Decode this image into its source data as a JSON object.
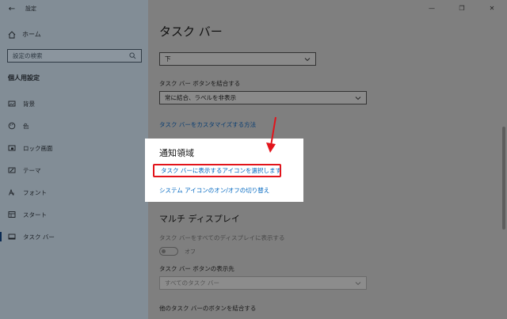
{
  "window": {
    "title": "設定"
  },
  "sidebar": {
    "home": "ホーム",
    "search_placeholder": "設定の検索",
    "section_title": "個人用設定",
    "items": [
      {
        "label": "背景",
        "icon": "image-icon"
      },
      {
        "label": "色",
        "icon": "palette-icon"
      },
      {
        "label": "ロック画面",
        "icon": "lock-screen-icon"
      },
      {
        "label": "テーマ",
        "icon": "theme-icon"
      },
      {
        "label": "フォント",
        "icon": "font-icon"
      },
      {
        "label": "スタート",
        "icon": "start-icon"
      },
      {
        "label": "タスク バー",
        "icon": "taskbar-icon",
        "active": true
      }
    ]
  },
  "main": {
    "title": "タスク バー",
    "position_dropdown": "下",
    "combine_label": "タスク バー ボタンを結合する",
    "combine_dropdown": "常に結合、ラベルを非表示",
    "customize_link": "タスク バーをカスタマイズする方法",
    "notification": {
      "title": "通知領域",
      "link_icons": "タスク バーに表示するアイコンを選択します",
      "link_system": "システム アイコンのオン/オフの切り替え"
    },
    "multi_display": {
      "title": "マルチ ディスプレイ",
      "show_all_label": "タスク バーをすべてのディスプレイに表示する",
      "toggle_state": "オフ",
      "buttons_on_label": "タスク バー ボタンの表示先",
      "buttons_on_dropdown": "すべてのタスク バー",
      "other_combine_label": "他のタスク バーのボタンを結合する"
    }
  },
  "colors": {
    "highlight_border": "#e2141b",
    "link": "#0067c0",
    "arrow": "#e2141b"
  }
}
